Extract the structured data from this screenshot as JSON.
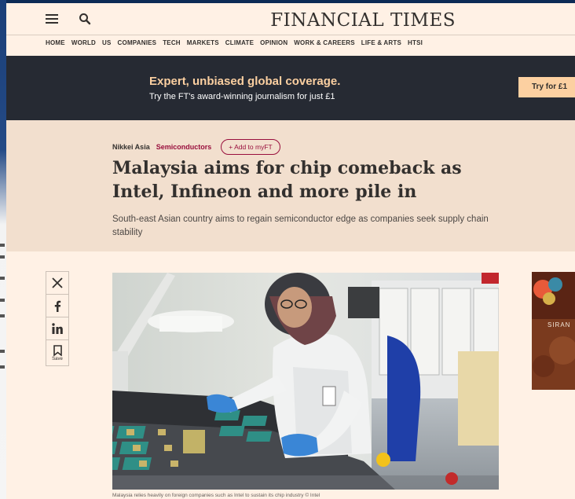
{
  "header": {
    "brand": "FINANCIAL TIMES",
    "icons": [
      "hamburger-menu-icon",
      "search-icon"
    ]
  },
  "nav": {
    "items": [
      "HOME",
      "WORLD",
      "US",
      "COMPANIES",
      "TECH",
      "MARKETS",
      "CLIMATE",
      "OPINION",
      "WORK & CAREERS",
      "LIFE & ARTS",
      "HTSI"
    ]
  },
  "promo": {
    "headline": "Expert, unbiased global coverage.",
    "subtext": "Try the FT's award-winning journalism for just £1",
    "button_label": "Try for £1"
  },
  "article": {
    "source": "Nikkei Asia",
    "topic": "Semiconductors",
    "add_button_label": "+ Add to myFT",
    "headline": "Malaysia aims for chip comeback as Intel, Infineon and more pile in",
    "standfirst": "South-east Asian country aims to regain semiconductor edge as companies seek supply chain stability",
    "image_caption": "Malaysia relies heavily on foreign companies such as Intel to sustain its chip industry © Intel"
  },
  "share": {
    "buttons": [
      "x-icon",
      "facebook-icon",
      "linkedin-icon",
      "bookmark-icon"
    ],
    "save_label": "Save"
  },
  "ad": {
    "text": "SIRAN"
  },
  "colors": {
    "page_bg": "#fff1e5",
    "band_bg": "#f2dfce",
    "promo_bg": "#262a33",
    "promo_accent": "#fcd0a1",
    "claret": "#990f3d",
    "text": "#33302e"
  }
}
